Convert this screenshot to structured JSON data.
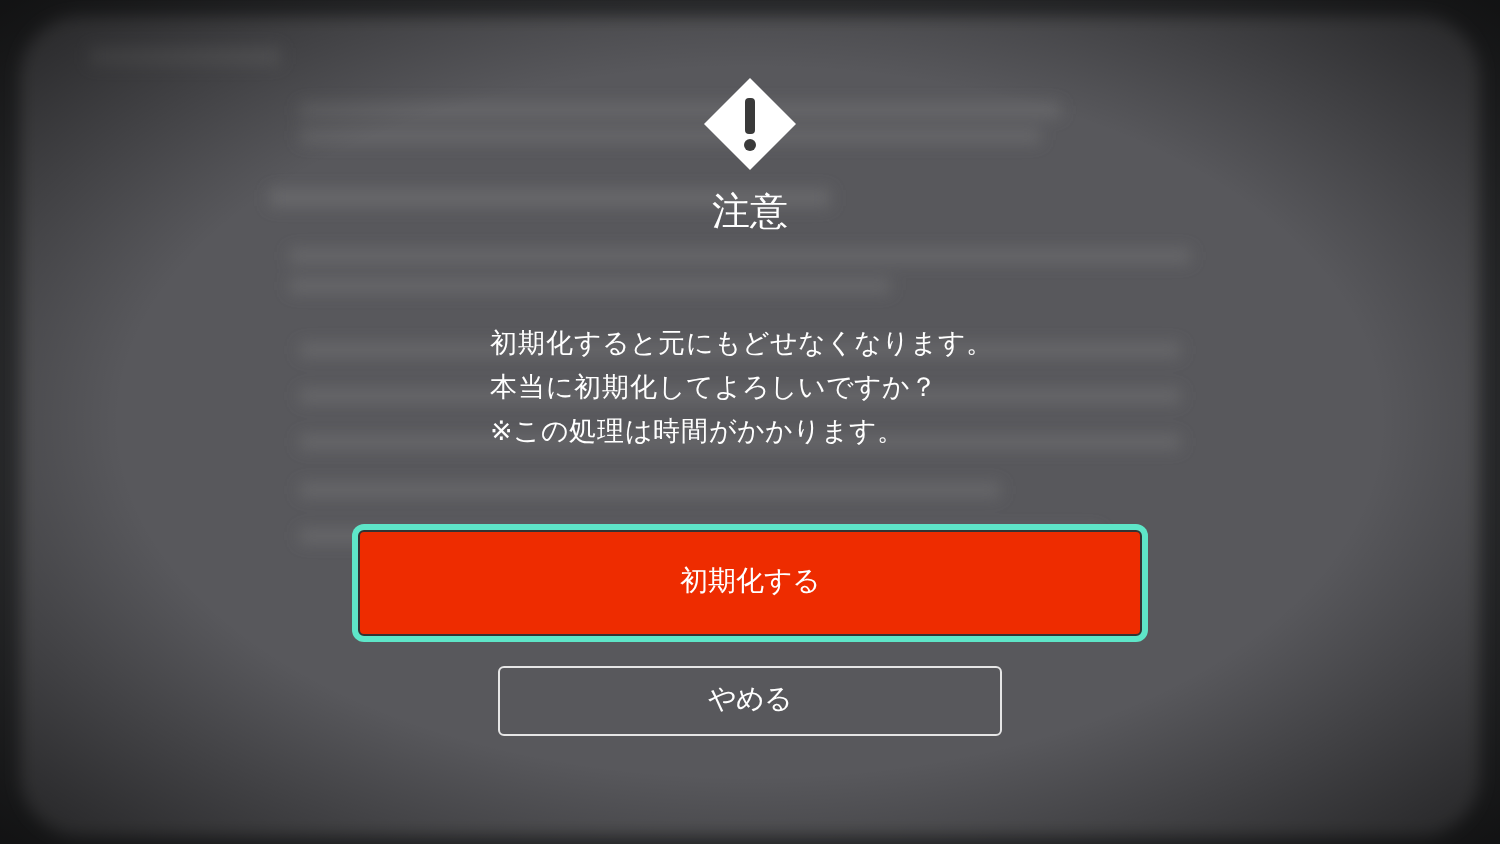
{
  "dialog": {
    "title": "注意",
    "message_lines": [
      "初期化すると元にもどせなくなります。",
      "本当に初期化してよろしいですか？",
      "※この処理は時間がかかります。"
    ],
    "buttons": [
      {
        "label": "初期化する",
        "kind": "primary",
        "focused": true
      },
      {
        "label": "やめる",
        "kind": "secondary",
        "focused": false
      }
    ]
  }
}
